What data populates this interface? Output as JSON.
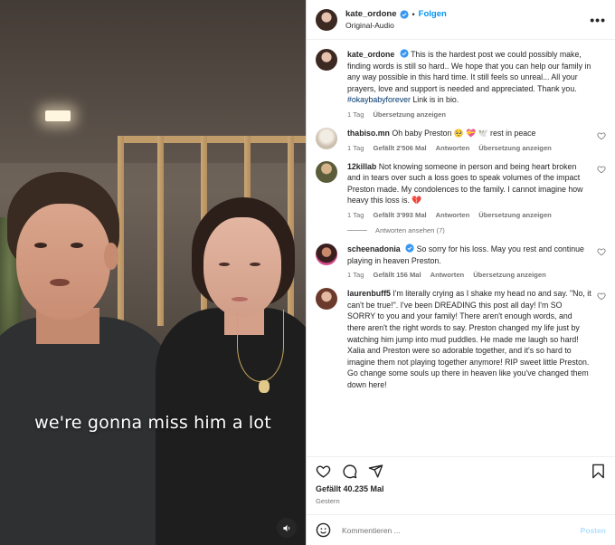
{
  "video": {
    "caption": "we're gonna miss him a lot",
    "mute_icon": "speaker-icon"
  },
  "header": {
    "username": "kate_ordone",
    "separator": "•",
    "follow_label": "Folgen",
    "audio_label": "Original-Audio",
    "more_label": "•••"
  },
  "post": {
    "username": "kate_ordone",
    "text": "This is the hardest post we could possibly make, finding words is still so hard.. We hope that you can help our family in any way possible in this hard time. It still feels so unreal... All your prayers, love and support is needed and appreciated. Thank you.",
    "hashtag": "#okaybabyforever",
    "text_after": " Link is in bio.",
    "time": "1 Tag",
    "translate": "Übersetzung anzeigen"
  },
  "comments": [
    {
      "username": "thabiso.mn",
      "text": "Oh baby Preston 🥺 💝 🕊️ rest in peace",
      "time": "1 Tag",
      "likes": "Gefällt 2'506 Mal",
      "reply": "Antworten",
      "translate": "Übersetzung anzeigen",
      "avatar_color": "#d9d2c6"
    },
    {
      "username": "12killab",
      "text": "Not knowing someone in person and being heart broken and in tears over such a loss goes to speak volumes of the impact Preston made. My condolences to the family. I cannot imagine how heavy this loss is. 💔",
      "time": "1 Tag",
      "likes": "Gefällt 3'993 Mal",
      "reply": "Antworten",
      "translate": "Übersetzung anzeigen",
      "avatar_color": "#6b6f48",
      "replies_label": "Antworten ansehen (7)"
    },
    {
      "username": "scheenadonia",
      "text": "So sorry for his loss. May you rest and continue playing in heaven Preston.",
      "time": "1 Tag",
      "likes": "Gefällt 156 Mal",
      "reply": "Antworten",
      "translate": "Übersetzung anzeigen",
      "avatar_color": "#4a2b2b",
      "verified": true
    },
    {
      "username": "laurenbuff5",
      "text": "I'm literally crying as I shake my head no and say. \"No, it can't be true!\". I've been DREADING this post all day! I'm SO SORRY to you and your family! There aren't enough words, and there aren't the right words to say. Preston changed my life just by watching him jump into mud puddles. He made me laugh so hard! Xalia and Preston were so adorable together, and it's so hard to imagine them not playing together anymore! RIP sweet little Preston. Go change some souls up there in heaven like you've changed them down here!",
      "avatar_color": "#8a5a4a"
    }
  ],
  "actions": {
    "likes": "Gefällt 40.235 Mal",
    "date": "Gestern"
  },
  "composer": {
    "placeholder": "Kommentieren ...",
    "post_label": "Posten"
  },
  "colors": {
    "link_blue": "#0095f6",
    "verified_blue": "#3897f0",
    "heart_red": "#ed4956"
  }
}
